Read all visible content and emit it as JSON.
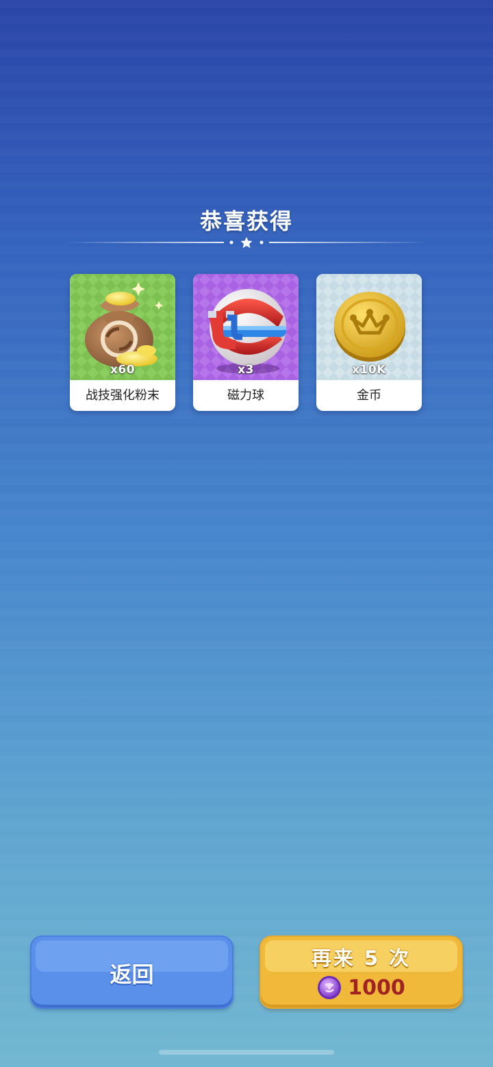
{
  "header": {
    "title": "恭喜获得"
  },
  "rewards": [
    {
      "name": "战技强化粉末",
      "quantity": "x60",
      "icon": "powder-bag-icon",
      "bg": "#86c95a"
    },
    {
      "name": "磁力球",
      "quantity": "x3",
      "icon": "magnet-ball-icon",
      "bg": "#b16ee8"
    },
    {
      "name": "金币",
      "quantity": "x10K",
      "icon": "gold-coin-icon",
      "bg": "#cfe0e8"
    }
  ],
  "buttons": {
    "back_label": "返回",
    "again_label": "再来 5 次",
    "again_cost": "1000",
    "cost_icon": "purple-gem-coin-icon"
  },
  "colors": {
    "back_button": "#5a8fea",
    "again_button": "#f0b93a",
    "cost_text": "#a02222"
  }
}
